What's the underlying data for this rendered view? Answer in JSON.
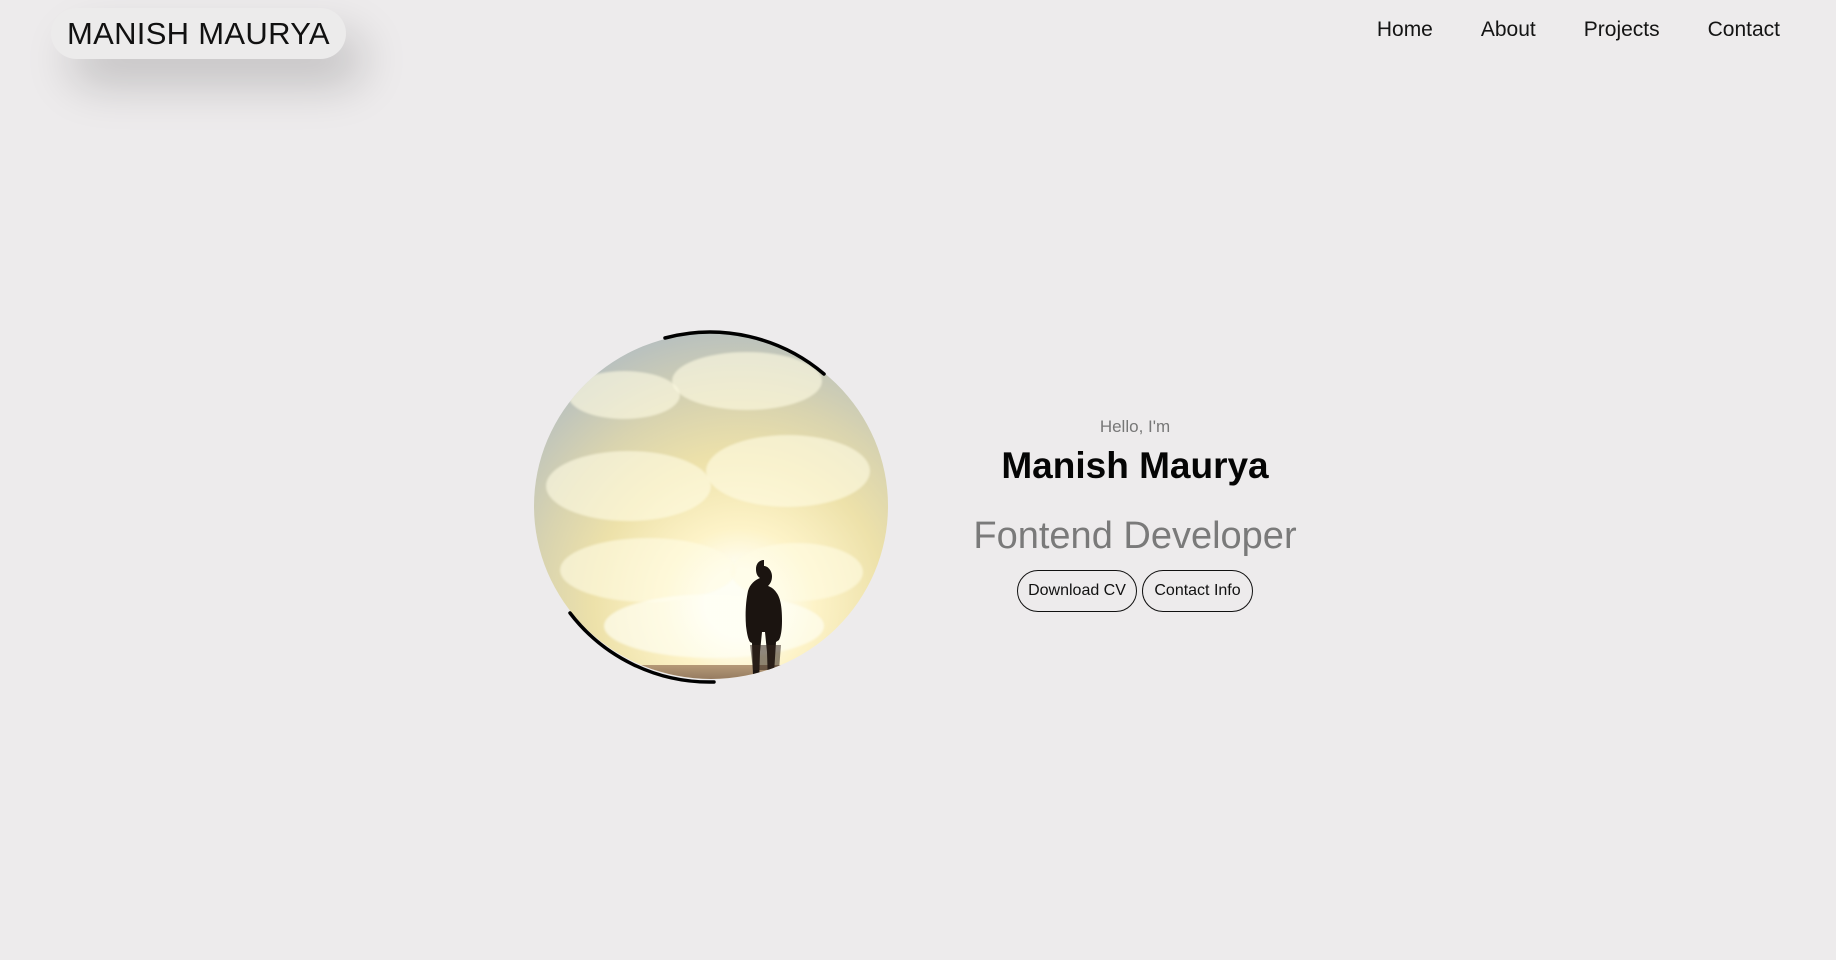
{
  "header": {
    "logo": "MANISH MAURYA",
    "nav": [
      {
        "label": "Home"
      },
      {
        "label": "About"
      },
      {
        "label": "Projects"
      },
      {
        "label": "Contact"
      }
    ]
  },
  "hero": {
    "greeting": "Hello, I'm",
    "name": "Manish Maurya",
    "role": "Fontend Developer",
    "buttons": {
      "download_cv": "Download CV",
      "contact_info": "Contact Info"
    },
    "profile_image": {
      "icon": "profile-silhouette-image"
    }
  },
  "colors": {
    "page_background": "#edebec",
    "text_primary": "#050505",
    "text_secondary": "#777777",
    "ring": "#000000"
  }
}
